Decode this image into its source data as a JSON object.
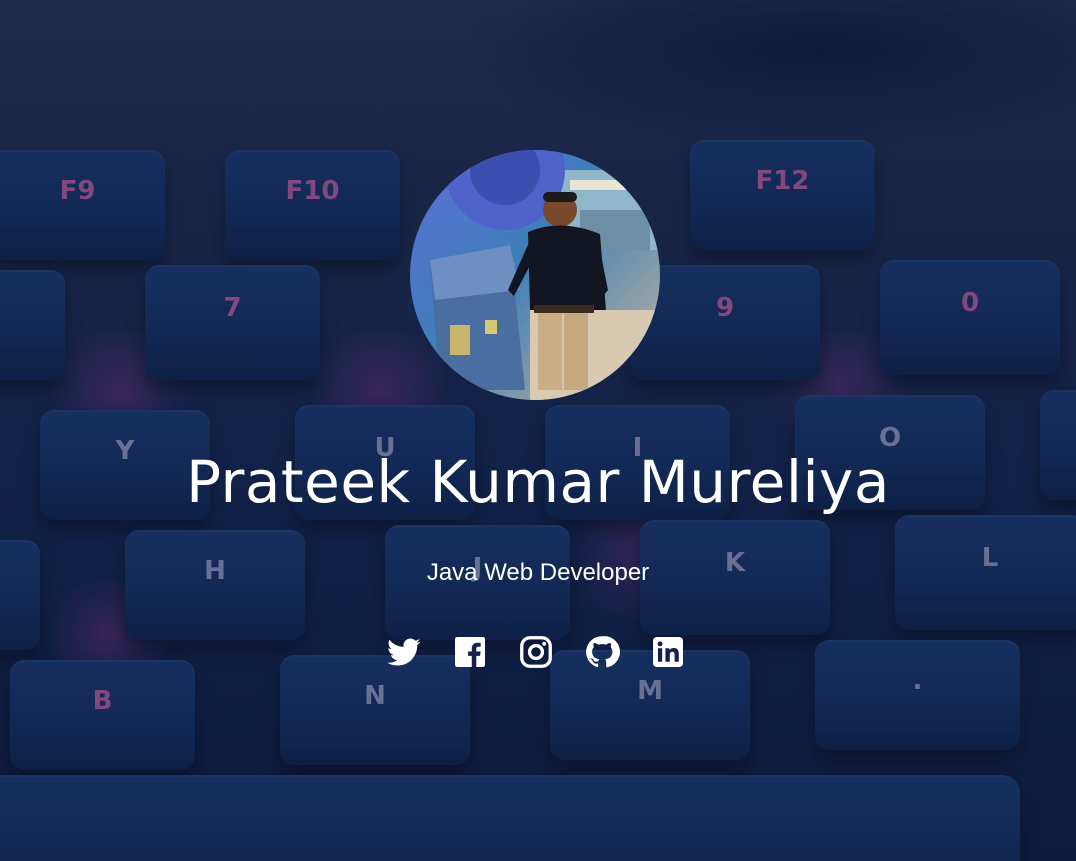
{
  "profile": {
    "name": "Prateek Kumar Mureliya",
    "role": "Java Web Developer",
    "avatar_alt": "profile-photo"
  },
  "social_links": [
    {
      "name": "twitter",
      "icon": "twitter-icon"
    },
    {
      "name": "facebook",
      "icon": "facebook-icon"
    },
    {
      "name": "instagram",
      "icon": "instagram-icon"
    },
    {
      "name": "github",
      "icon": "github-icon"
    },
    {
      "name": "linkedin",
      "icon": "linkedin-icon"
    }
  ],
  "background": {
    "description_keys": [
      "F9",
      "F10",
      "F12",
      "7",
      "9",
      "0",
      "Y",
      "U",
      "I",
      "O",
      "H",
      "J",
      "K",
      "L",
      "B",
      "N",
      "M",
      "."
    ]
  },
  "colors": {
    "background_dark": "#0e1c40",
    "keycap": "#1d3d75",
    "key_glow": "#c83caa",
    "text": "#ffffff"
  }
}
